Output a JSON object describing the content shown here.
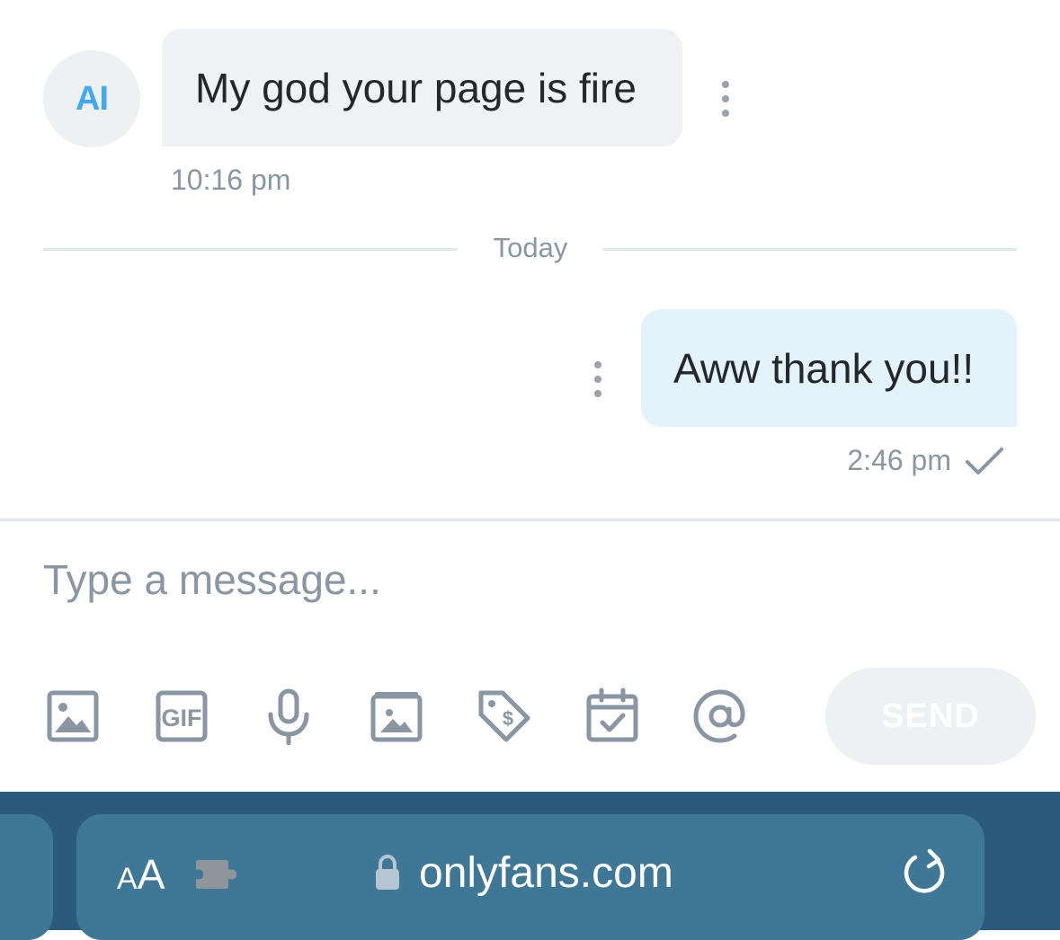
{
  "conversation": {
    "incoming": {
      "avatar_initials": "AI",
      "text": "My god your page is fire",
      "time": "10:16 pm"
    },
    "divider_label": "Today",
    "outgoing": {
      "text": "Aww thank you!!",
      "time": "2:46 pm",
      "status": "sent-check"
    }
  },
  "composer": {
    "placeholder": "Type a message...",
    "value": "",
    "tools": [
      "image-icon",
      "gif-icon",
      "microphone-icon",
      "vault-media-icon",
      "price-tag-icon",
      "calendar-icon",
      "mention-icon"
    ],
    "send_label": "SEND"
  },
  "browser": {
    "text_size_label_small": "A",
    "text_size_label_large": "A",
    "url": "onlyfans.com"
  },
  "colors": {
    "incoming_bubble": "#f0f1f3",
    "outgoing_bubble": "#e2f3fb",
    "accent": "#3fa9f5",
    "muted_text": "#8a96a3",
    "browser_bar": "#2b5b7a",
    "address_pill": "#3f7797"
  }
}
